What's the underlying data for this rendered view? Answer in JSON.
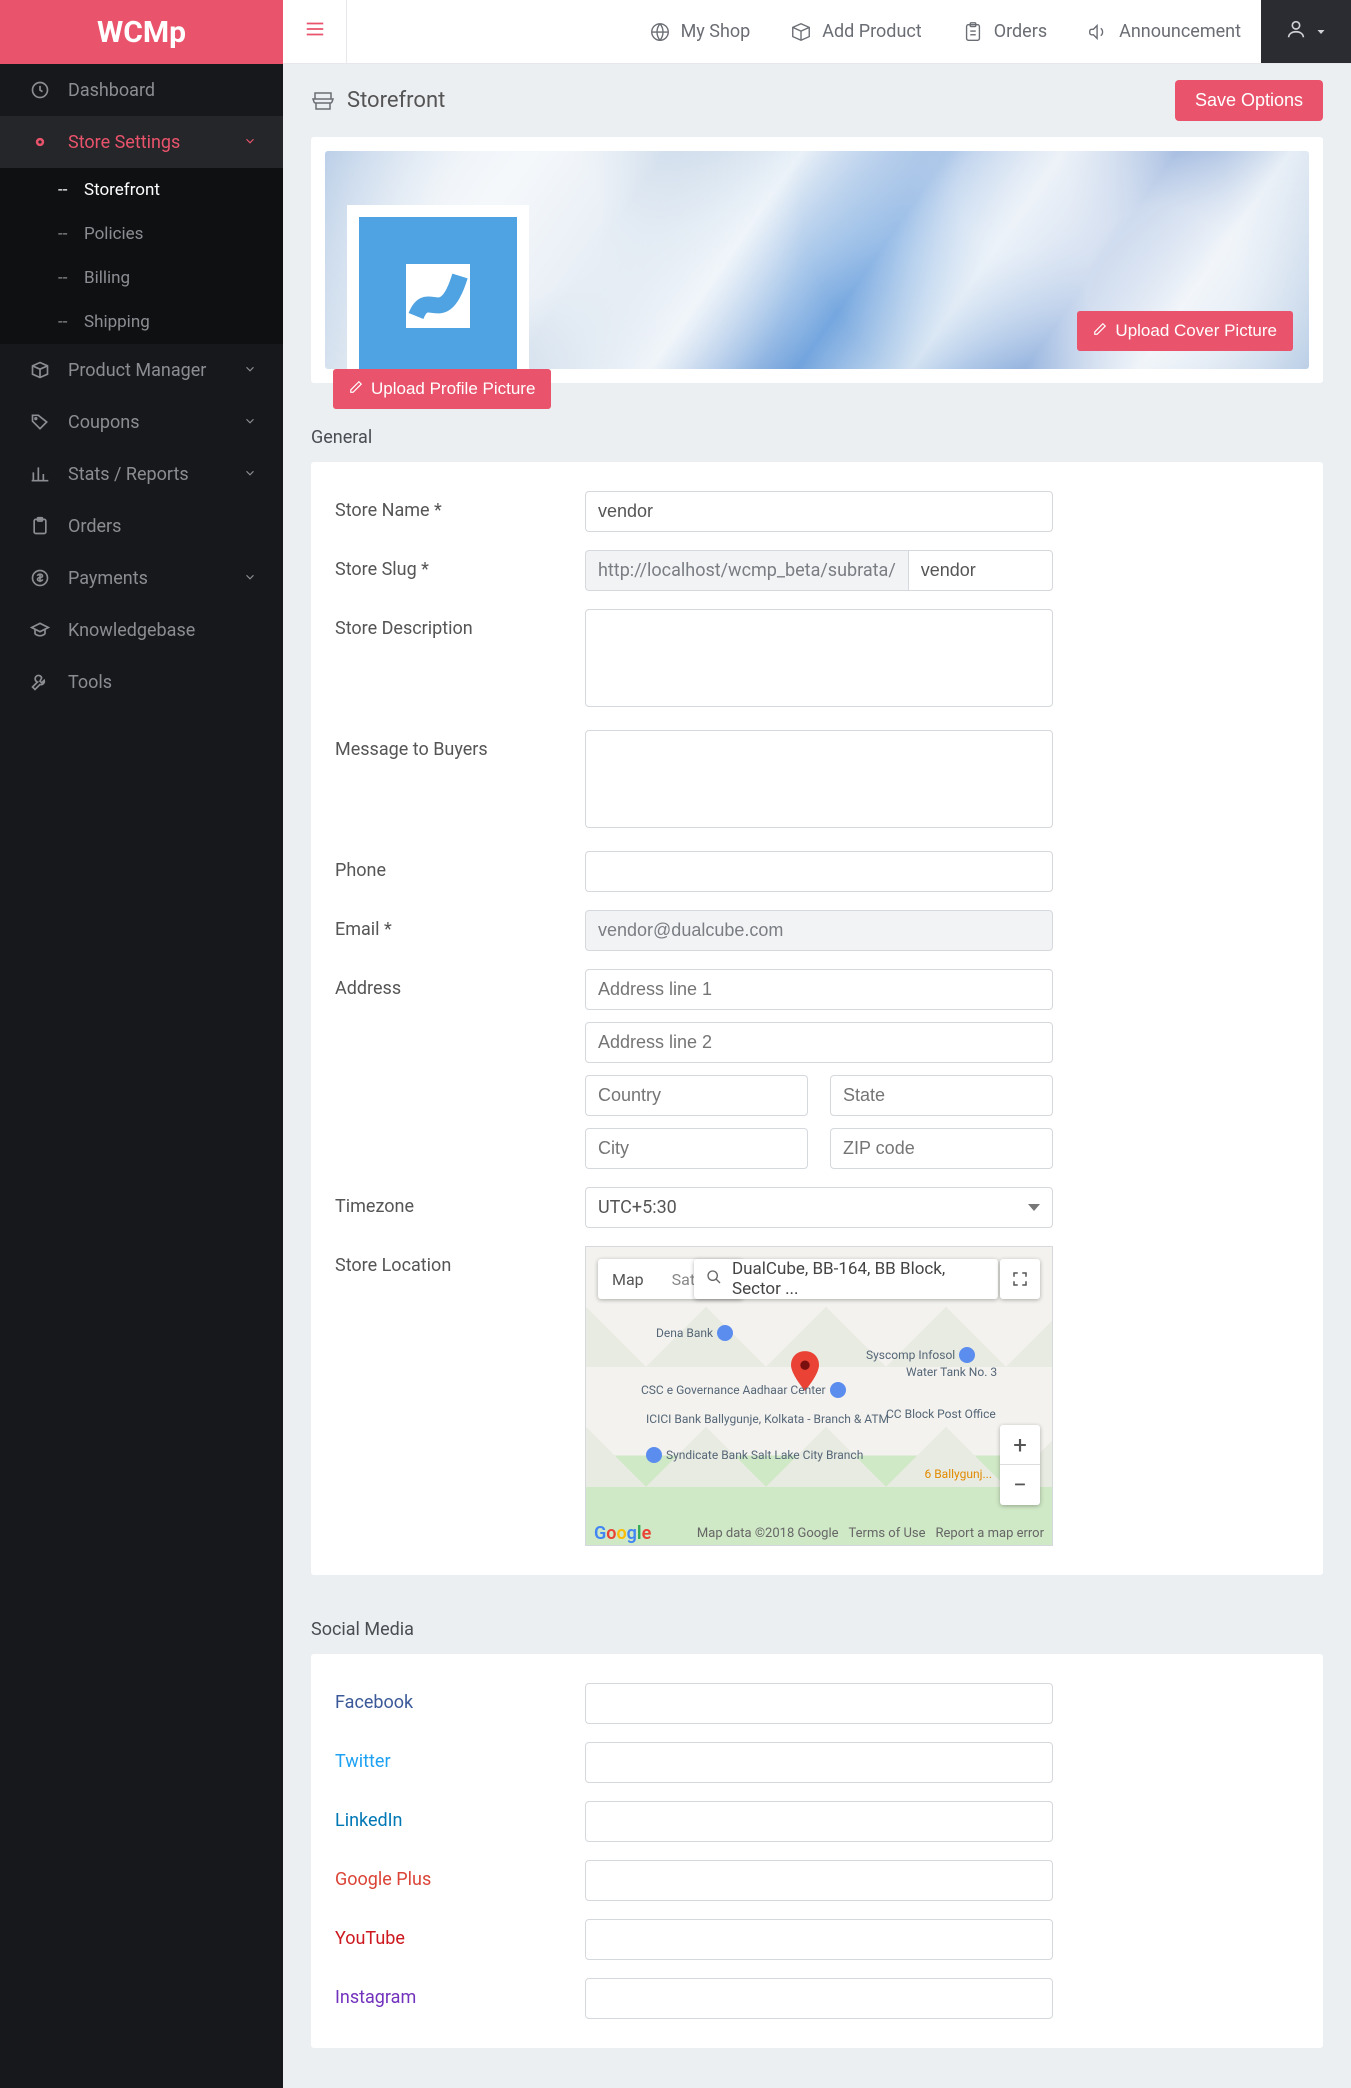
{
  "brand": "WCMp",
  "topnav": {
    "my_shop": "My Shop",
    "add_product": "Add Product",
    "orders": "Orders",
    "announcement": "Announcement"
  },
  "sidebar": {
    "dashboard": "Dashboard",
    "store_settings": "Store Settings",
    "sub_storefront": "Storefront",
    "sub_policies": "Policies",
    "sub_billing": "Billing",
    "sub_shipping": "Shipping",
    "product_manager": "Product Manager",
    "coupons": "Coupons",
    "stats": "Stats / Reports",
    "orders": "Orders",
    "payments": "Payments",
    "knowledgebase": "Knowledgebase",
    "tools": "Tools"
  },
  "page": {
    "title": "Storefront",
    "save": "Save Options",
    "upload_cover": "Upload Cover Picture",
    "upload_profile": "Upload Profile Picture"
  },
  "sections": {
    "general": "General",
    "social": "Social Media"
  },
  "labels": {
    "store_name": "Store Name *",
    "store_slug": "Store Slug *",
    "store_desc": "Store Description",
    "msg_buyers": "Message to Buyers",
    "phone": "Phone",
    "email": "Email *",
    "address": "Address",
    "timezone": "Timezone",
    "location": "Store Location"
  },
  "values": {
    "store_name": "vendor",
    "slug_prefix": "http://localhost/wcmp_beta/subrata/",
    "slug": "vendor",
    "store_desc": "",
    "msg_buyers": "",
    "phone": "",
    "email": "vendor@dualcube.com",
    "addr1": "",
    "addr2": "",
    "country": "",
    "state": "",
    "city": "",
    "zip": "",
    "timezone": "UTC+5:30"
  },
  "placeholders": {
    "addr1": "Address line 1",
    "addr2": "Address line 2",
    "country": "Country",
    "state": "State",
    "city": "City",
    "zip": "ZIP code"
  },
  "map": {
    "type_map": "Map",
    "type_sat": "Satellite",
    "search": "DualCube, BB-164, BB Block, Sector ...",
    "attribution": "Map data ©2018 Google",
    "terms": "Terms of Use",
    "report": "Report a map error",
    "poi1": "Dena Bank",
    "poi2": "Syscomp Infosol",
    "poi3": "CSC e Governance Aadhaar Center",
    "poi4": "ICICI Bank Ballygunje, Kolkata - Branch & ATM",
    "poi5": "Syndicate Bank Salt Lake City Branch",
    "poi6": "CC Block Post Office",
    "poi7": "Water Tank No. 3",
    "poi8": "6 Ballygunj..."
  },
  "social": {
    "facebook": "Facebook",
    "twitter": "Twitter",
    "linkedin": "LinkedIn",
    "google_plus": "Google Plus",
    "youtube": "YouTube",
    "instagram": "Instagram"
  }
}
